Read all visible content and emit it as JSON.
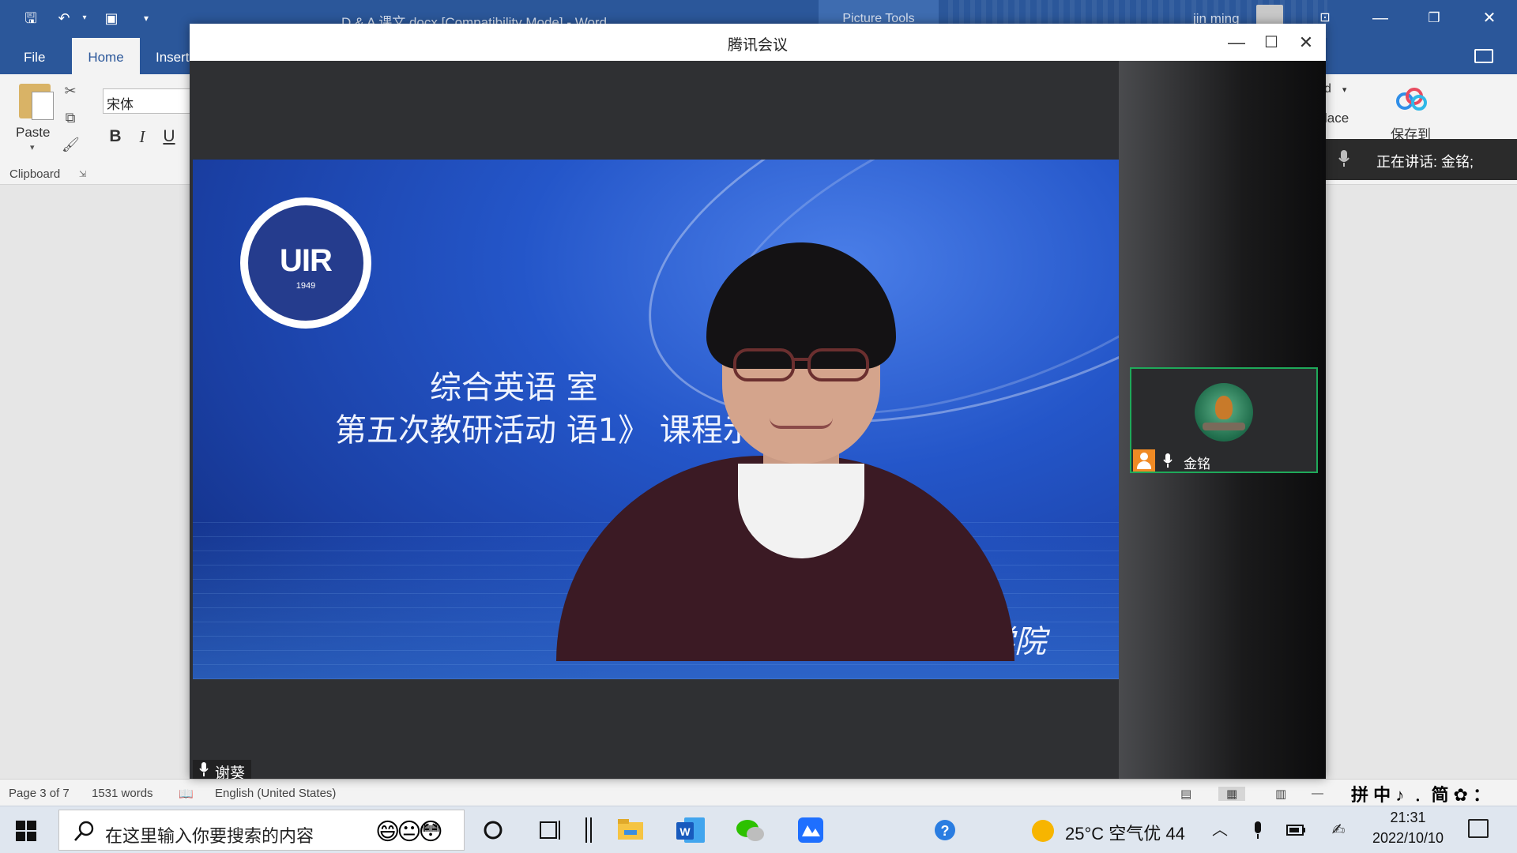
{
  "word": {
    "doc_title": "D & A 课文.docx [Compatibility Mode] - Word",
    "picture_tools": "Picture Tools",
    "user_name": "jin ming",
    "tabs": [
      {
        "label": "File"
      },
      {
        "label": "Home"
      },
      {
        "label": "Insert"
      }
    ],
    "ribbon": {
      "paste_label": "Paste",
      "clipboard_label": "Clipboard",
      "font_name": "宋体",
      "bold": "B",
      "italic": "I",
      "underline": "U",
      "right_partial_1": "d",
      "right_partial_2": "lace",
      "save_to_label": "保存到"
    },
    "status": {
      "page": "Page 3 of 7",
      "words": "1531 words",
      "language": "English (United States)",
      "ime": "拼 中 ♪ ﹒ 简 ✿ ："
    }
  },
  "meeting": {
    "title": "腾讯会议",
    "speaking_banner": "正在讲话: 金铭;",
    "main_speaker": "谢葵",
    "slide": {
      "logo_text": "UIR",
      "logo_year": "1949",
      "line1": "综合英语                                  室",
      "line2": "第五次教研活动              语1》 课程示范课",
      "line3": "关系学院"
    },
    "participant": {
      "name": "金铭"
    }
  },
  "taskbar": {
    "search_placeholder": "在这里输入你要搜索的内容",
    "search_emoji": "😄😐😳",
    "weather": "25°C  空气优 44",
    "time": "21:31",
    "date": "2022/10/10"
  },
  "colors": {
    "word_blue": "#2b579a",
    "meeting_dark": "#2f3033",
    "active_border": "#1fa95a",
    "host_badge": "#f08a24"
  }
}
